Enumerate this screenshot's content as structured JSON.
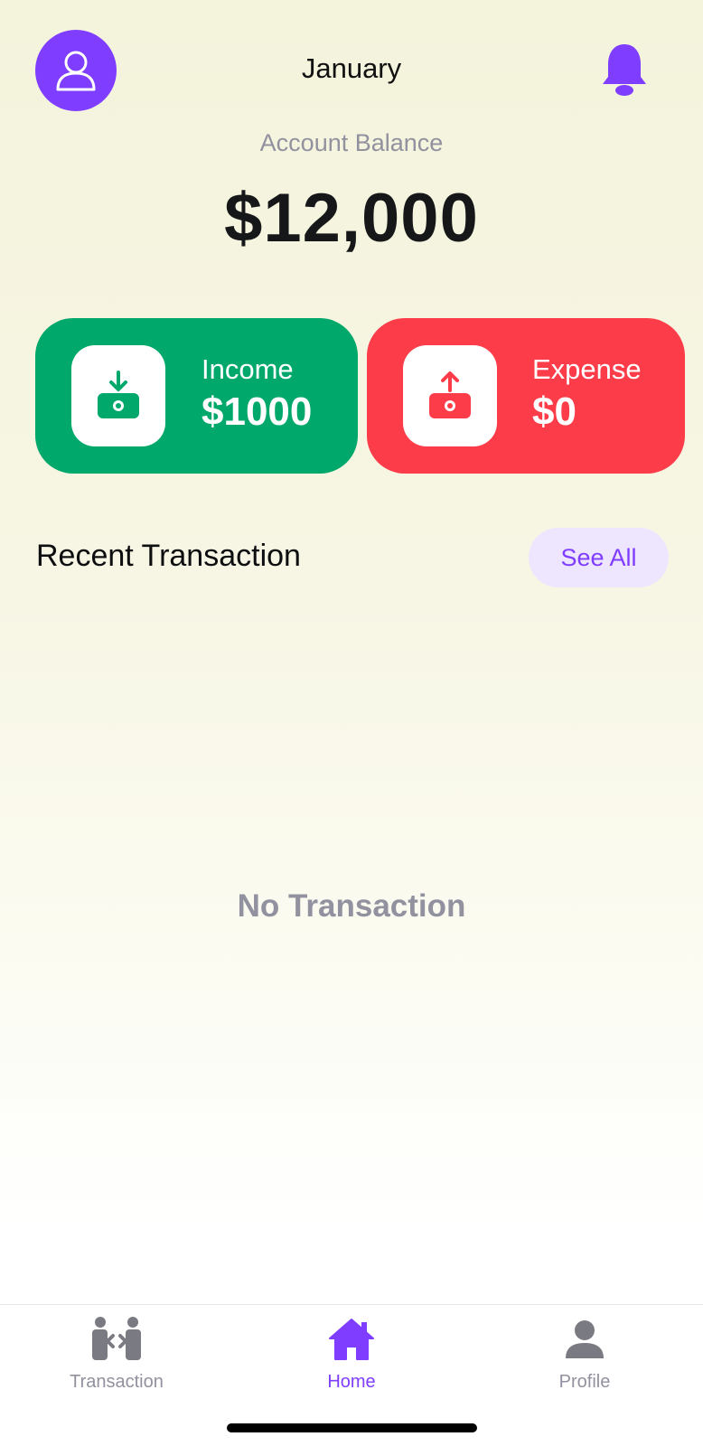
{
  "header": {
    "month": "January",
    "avatar_icon": "user-outline-icon",
    "notification_icon": "bell-icon"
  },
  "balance": {
    "label": "Account Balance",
    "value": "$12,000"
  },
  "cards": {
    "income": {
      "label": "Income",
      "amount": "$1000",
      "icon": "income-wallet-icon",
      "color": "#00a86b"
    },
    "expense": {
      "label": "Expense",
      "amount": "$0",
      "icon": "expense-wallet-icon",
      "color": "#fd3c4a"
    }
  },
  "recent": {
    "title": "Recent Transaction",
    "see_all": "See All",
    "empty_text": "No Transaction"
  },
  "nav": {
    "items": [
      {
        "label": "Transaction",
        "icon": "transaction-icon",
        "active": false
      },
      {
        "label": "Home",
        "icon": "home-icon",
        "active": true
      },
      {
        "label": "Profile",
        "icon": "profile-icon",
        "active": false
      }
    ]
  },
  "colors": {
    "accent": "#7f3dff",
    "muted": "#91919f"
  }
}
